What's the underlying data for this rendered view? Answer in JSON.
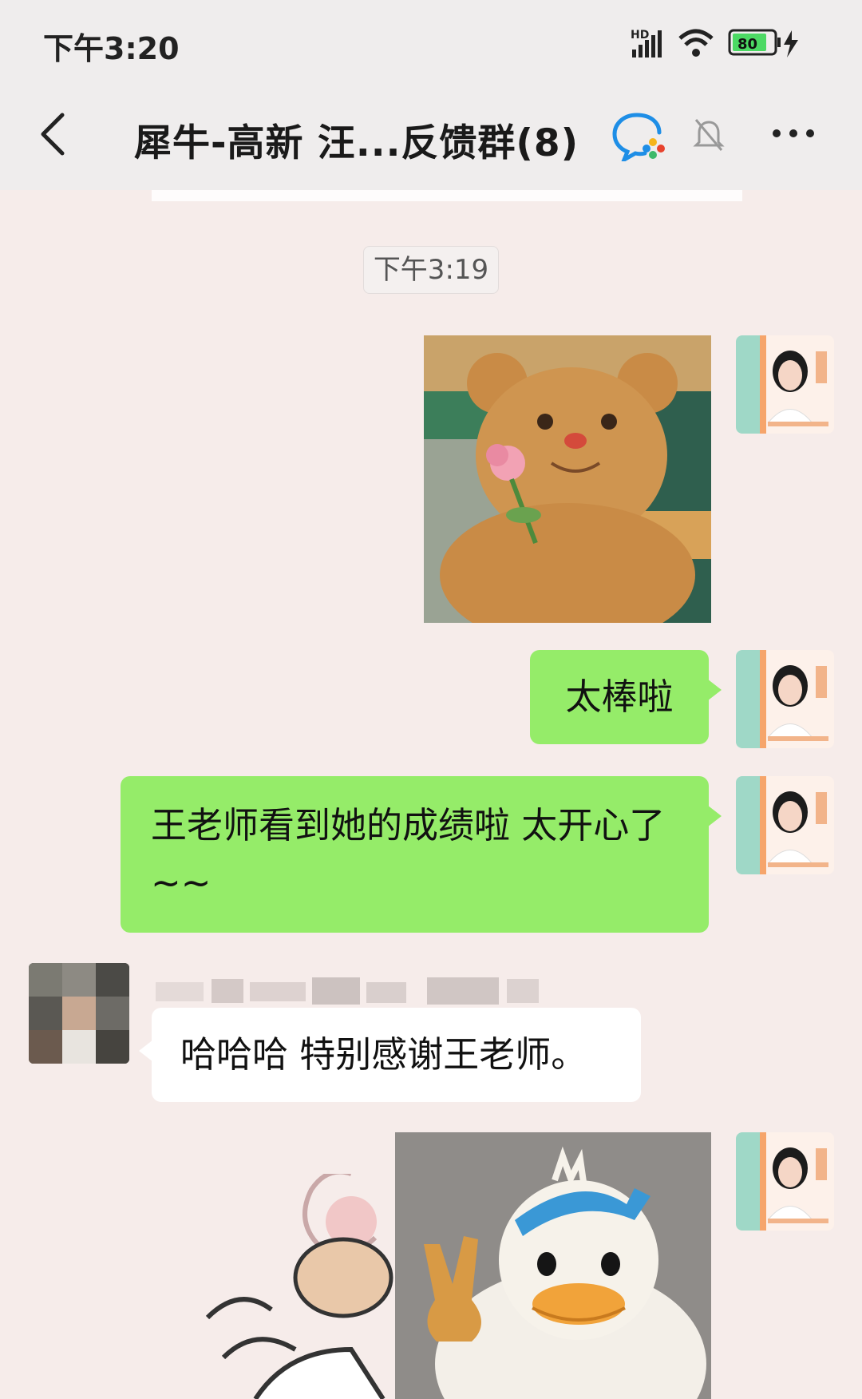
{
  "status_bar": {
    "time": "下午3:20",
    "network": "HD",
    "battery": "80"
  },
  "header": {
    "title": "犀牛-高新 汪...反馈群(8)"
  },
  "chat": {
    "timestamp": "下午3:19",
    "messages": [
      {
        "type": "image",
        "from": "self",
        "icon": "teddy-bear-rose-sticker"
      },
      {
        "type": "text",
        "from": "self",
        "text": "太棒啦"
      },
      {
        "type": "text",
        "from": "self",
        "text": "王老师看到她的成绩啦 太开心了~~"
      },
      {
        "type": "text",
        "from": "other",
        "text": "哈哈哈 特别感谢王老师。"
      },
      {
        "type": "image",
        "from": "self",
        "icon": "duck-peace-sign-sticker"
      }
    ]
  },
  "colors": {
    "green_bubble": "#95ec69",
    "chat_background": "#f6ecea",
    "header_background": "#efeded"
  }
}
